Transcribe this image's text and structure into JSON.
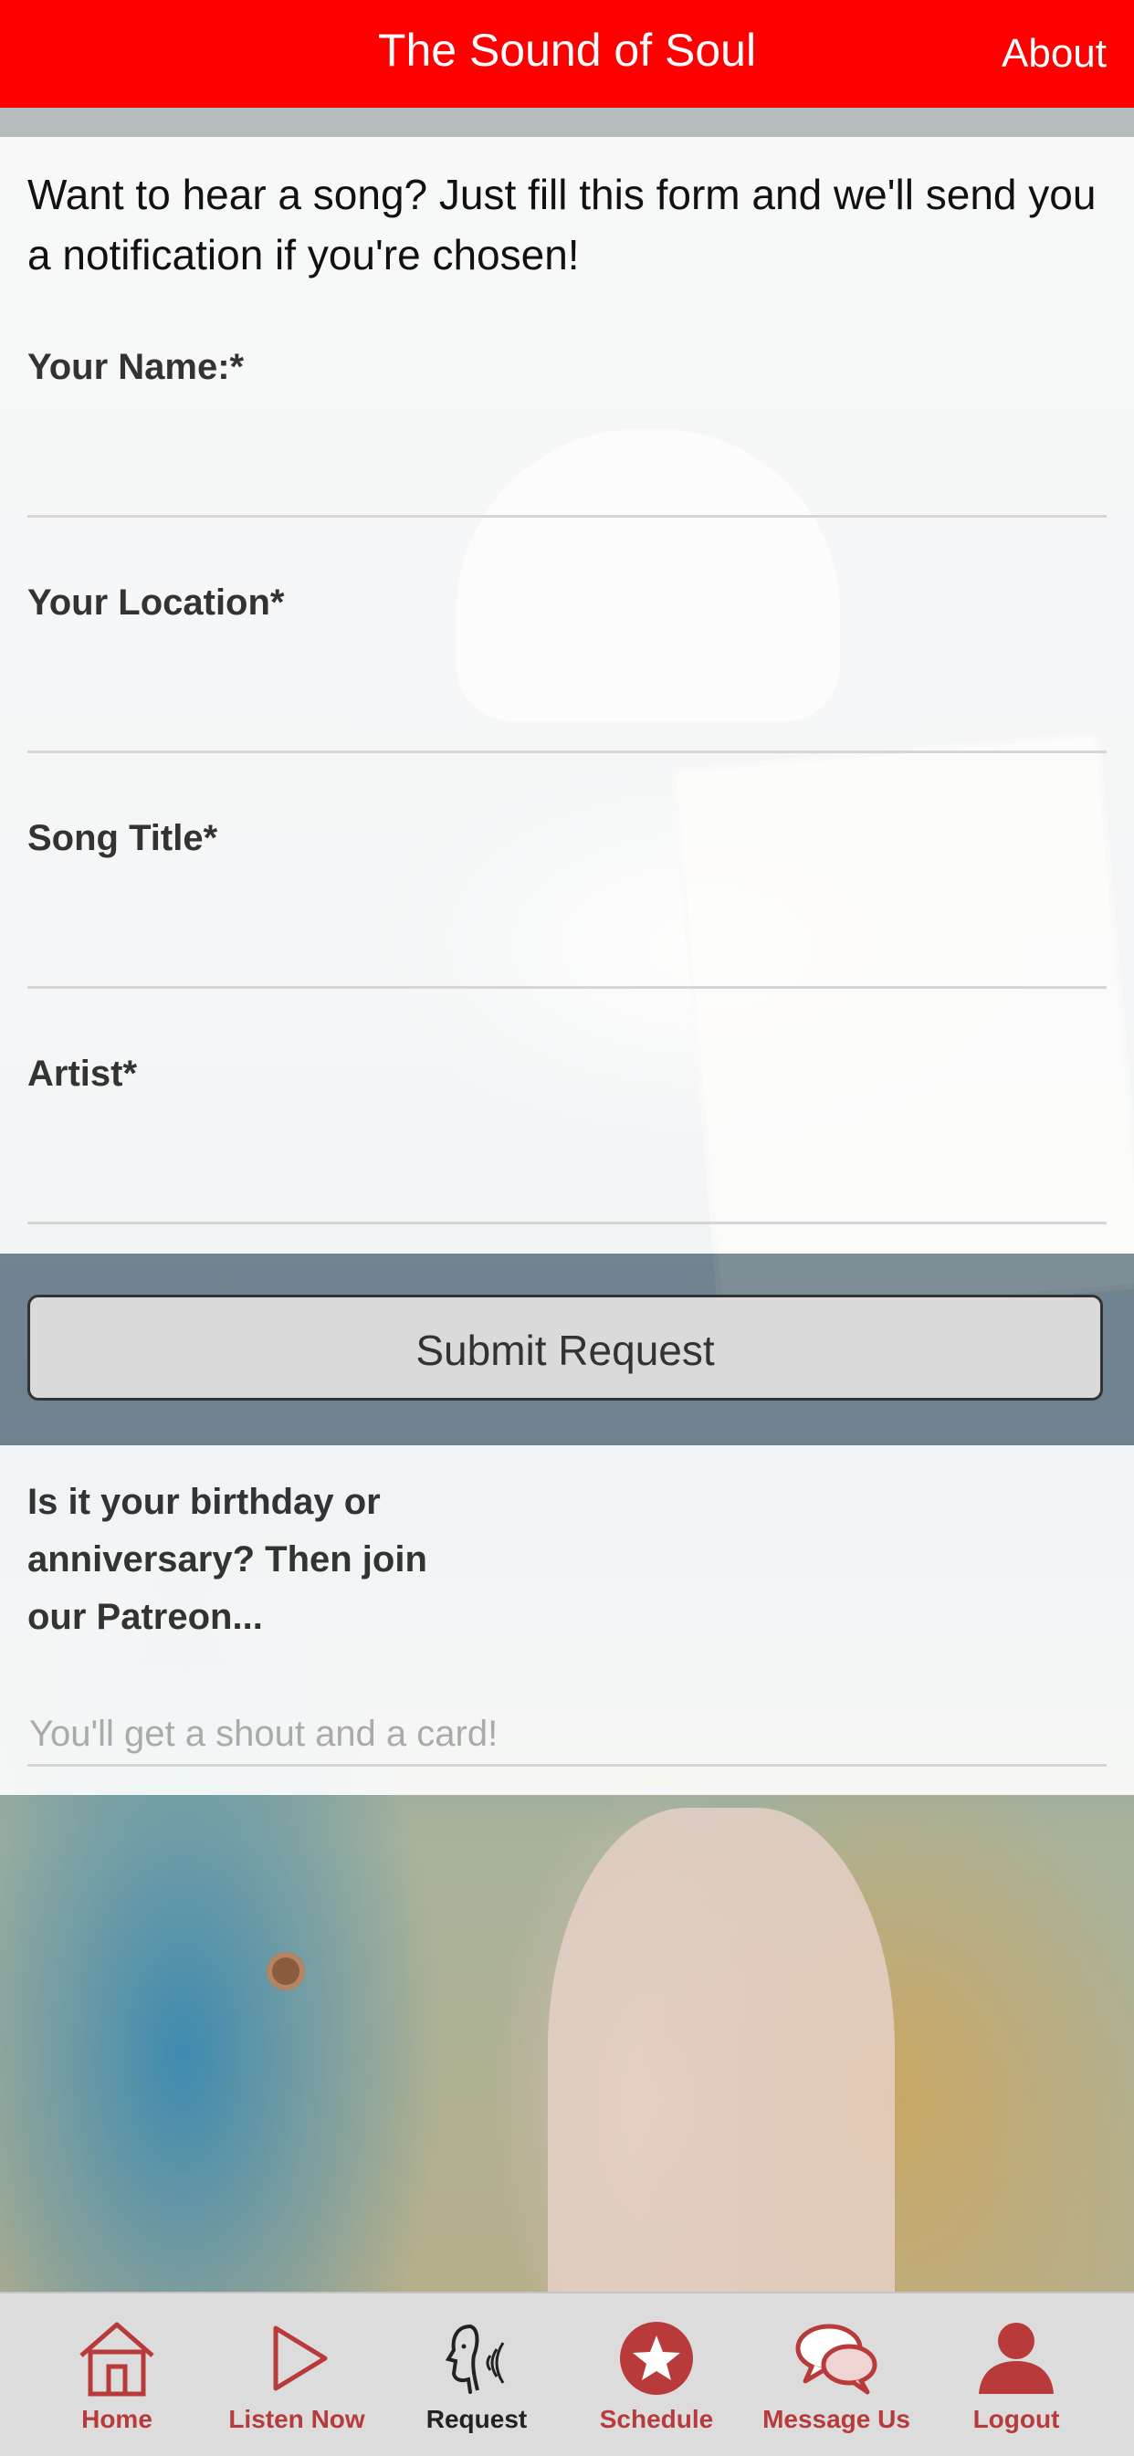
{
  "header": {
    "title": "The Sound of Soul",
    "about": "About"
  },
  "form": {
    "intro": "Want to hear a song? Just fill this form and we'll send you a notification if you're chosen!",
    "fields": [
      {
        "label": "Your Name:*",
        "value": ""
      },
      {
        "label": "Your Location*",
        "value": ""
      },
      {
        "label": "Song Title*",
        "value": ""
      },
      {
        "label": "Artist*",
        "value": ""
      }
    ],
    "submit_label": "Submit Request"
  },
  "patreon": {
    "text": "Is it your birthday or anniversary? Then join our Patreon...",
    "placeholder": "You'll get a shout and a card!"
  },
  "tabs": [
    {
      "label": "Home",
      "icon": "home-icon"
    },
    {
      "label": "Listen Now",
      "icon": "play-icon"
    },
    {
      "label": "Request",
      "icon": "request-icon",
      "active": true
    },
    {
      "label": "Schedule",
      "icon": "star-icon"
    },
    {
      "label": "Message Us",
      "icon": "chat-bubbles-icon"
    },
    {
      "label": "Logout",
      "icon": "user-icon"
    }
  ],
  "colors": {
    "accent": "#fe0000",
    "tab_label": "#b83a3a",
    "tab_active": "#222222"
  }
}
